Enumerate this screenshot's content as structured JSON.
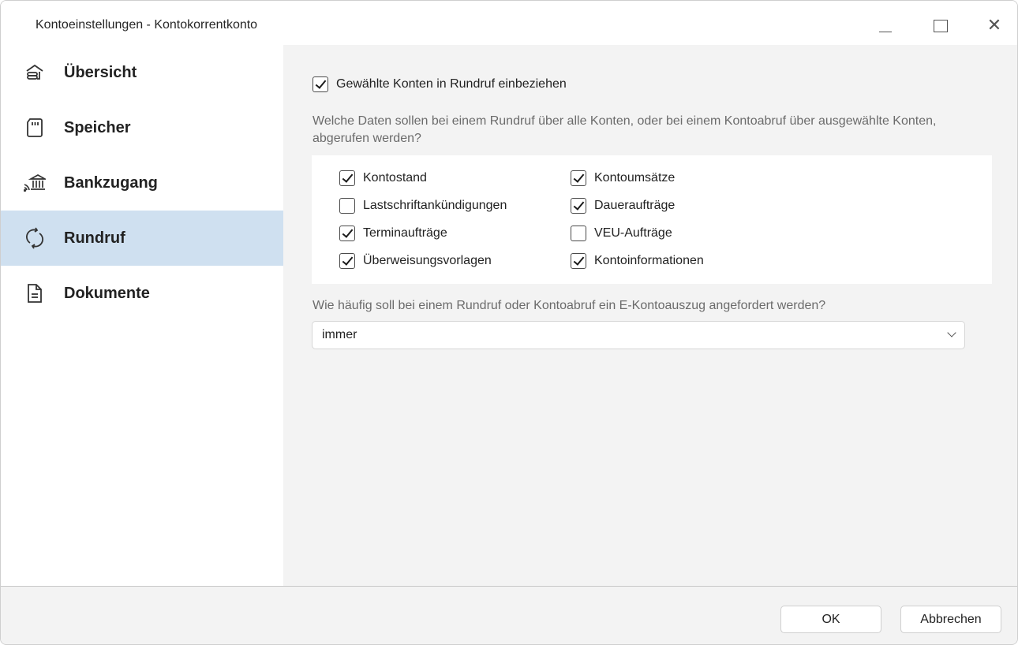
{
  "window": {
    "title": "Kontoeinstellungen - Kontokorrentkonto",
    "controls": {
      "minimize": "minimize-icon",
      "maximize": "maximize-icon",
      "close": "close-icon"
    }
  },
  "sidebar": {
    "items": [
      {
        "label": "Übersicht",
        "icon": "bank-overview-icon",
        "active": false
      },
      {
        "label": "Speicher",
        "icon": "sd-card-icon",
        "active": false
      },
      {
        "label": "Bankzugang",
        "icon": "bank-access-icon",
        "active": false
      },
      {
        "label": "Rundruf",
        "icon": "sync-icon",
        "active": true
      },
      {
        "label": "Dokumente",
        "icon": "document-icon",
        "active": false
      }
    ]
  },
  "main": {
    "include_checkbox": {
      "label": "Gewählte Konten in Rundruf einbeziehen",
      "checked": true
    },
    "question1": "Welche Daten sollen bei einem Rundruf über alle Konten, oder bei einem Kontoabruf über ausgewählte Konten, abgerufen werden?",
    "options": [
      {
        "label": "Kontostand",
        "checked": true
      },
      {
        "label": "Kontoumsätze",
        "checked": true
      },
      {
        "label": "Lastschriftankündigungen",
        "checked": false
      },
      {
        "label": "Daueraufträge",
        "checked": true
      },
      {
        "label": "Terminaufträge",
        "checked": true
      },
      {
        "label": "VEU-Aufträge",
        "checked": false
      },
      {
        "label": "Überweisungsvorlagen",
        "checked": true
      },
      {
        "label": "Kontoinformationen",
        "checked": true
      }
    ],
    "question2": "Wie häufig soll bei einem Rundruf oder Kontoabruf ein E-Kontoauszug angefordert werden?",
    "frequency_select": {
      "value": "immer"
    }
  },
  "footer": {
    "ok_label": "OK",
    "cancel_label": "Abbrechen"
  },
  "colors": {
    "active_nav_bg": "#cfe0f0",
    "window_bg": "#f3f3f3",
    "panel_bg": "#ffffff"
  }
}
